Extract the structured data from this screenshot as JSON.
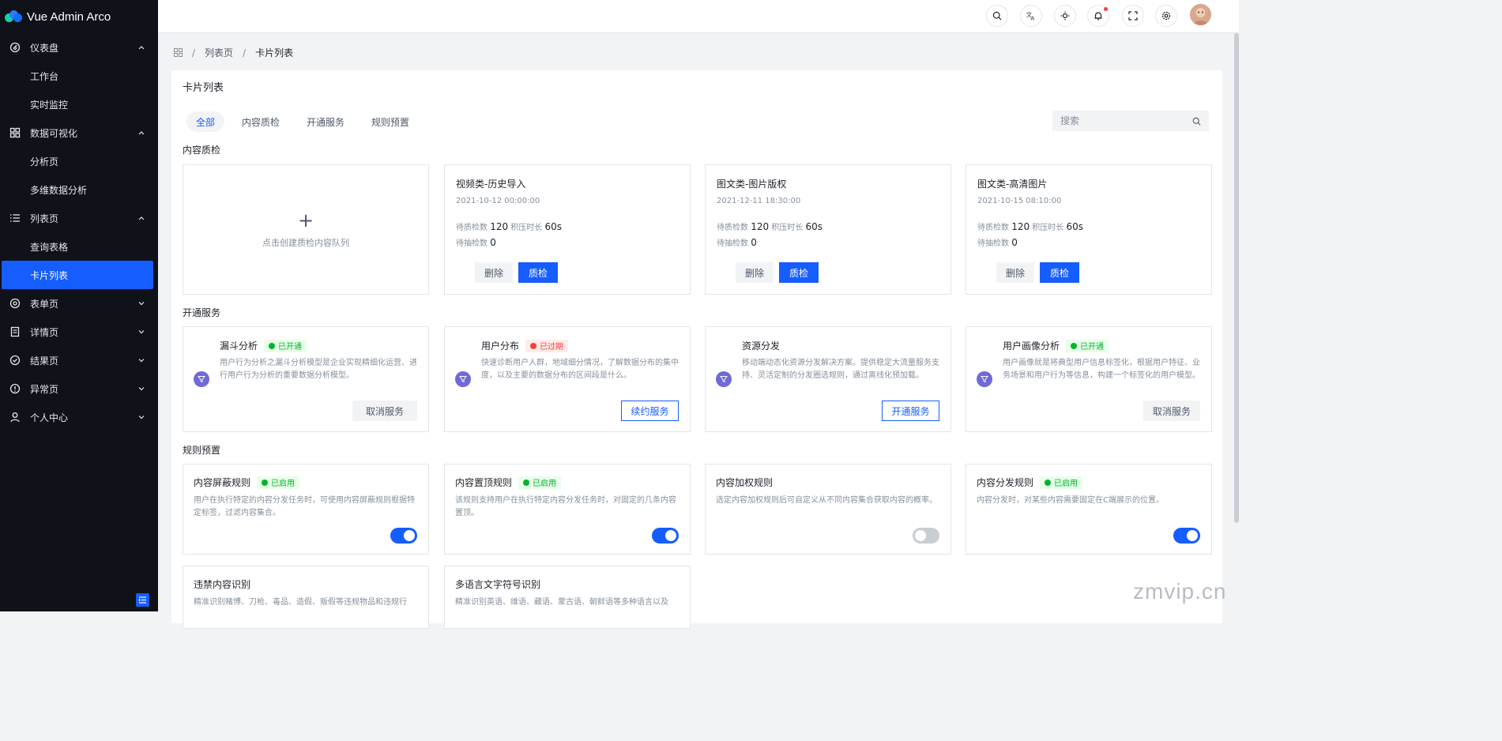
{
  "app": {
    "title": "Vue Admin Arco"
  },
  "sidebar": {
    "groups": [
      {
        "label": "仪表盘",
        "icon": "dashboard-icon",
        "expanded": true,
        "items": [
          "工作台",
          "实时监控"
        ]
      },
      {
        "label": "数据可视化",
        "icon": "grid-icon",
        "expanded": true,
        "items": [
          "分析页",
          "多维数据分析"
        ]
      },
      {
        "label": "列表页",
        "icon": "list-icon",
        "expanded": true,
        "items": [
          "查询表格",
          "卡片列表"
        ]
      },
      {
        "label": "表单页",
        "icon": "settings-icon",
        "expanded": false
      },
      {
        "label": "详情页",
        "icon": "file-icon",
        "expanded": false
      },
      {
        "label": "结果页",
        "icon": "check-circle-icon",
        "expanded": false
      },
      {
        "label": "异常页",
        "icon": "exclamation-circle-icon",
        "expanded": false
      },
      {
        "label": "个人中心",
        "icon": "user-icon",
        "expanded": false
      }
    ],
    "active_item": "卡片列表"
  },
  "header": {
    "icons": [
      "search-icon",
      "translate-icon",
      "theme-icon",
      "notification-icon",
      "fullscreen-icon",
      "settings-icon"
    ],
    "notification_dot": true
  },
  "breadcrumb": {
    "items": [
      "列表页",
      "卡片列表"
    ]
  },
  "page": {
    "title": "卡片列表",
    "tabs": [
      "全部",
      "内容质检",
      "开通服务",
      "规则预置"
    ],
    "active_tab": "全部",
    "search_placeholder": "搜索"
  },
  "quality": {
    "section_title": "内容质检",
    "add_text": "点击创建质检内容队列",
    "add_symbol": "+",
    "pending_label": "待质检数",
    "backlog_label": "积压时长",
    "sampling_label": "待抽检数",
    "delete_label": "删除",
    "inspect_label": "质检",
    "cards": [
      {
        "title": "视频类-历史导入",
        "time": "2021-10-12 00:00:00",
        "pending": "120",
        "backlog": "60s",
        "sampling": "0"
      },
      {
        "title": "图文类-图片版权",
        "time": "2021-12-11 18:30:00",
        "pending": "120",
        "backlog": "60s",
        "sampling": "0"
      },
      {
        "title": "图文类-高清图片",
        "time": "2021-10-15 08:10:00",
        "pending": "120",
        "backlog": "60s",
        "sampling": "0"
      }
    ]
  },
  "services": {
    "section_title": "开通服务",
    "cards": [
      {
        "title": "漏斗分析",
        "tag": "已开通",
        "tag_type": "ok",
        "desc": "用户行为分析之漏斗分析模型是企业实现精细化运营、进行用户行为分析的重要数据分析模型。",
        "action": "取消服务",
        "action_style": "gray"
      },
      {
        "title": "用户分布",
        "tag": "已过期",
        "tag_type": "bad",
        "desc": "快速诊断用户人群，地域细分情况，了解数据分布的集中度，以及主要的数据分布的区间段是什么。",
        "action": "续约服务",
        "action_style": "outline"
      },
      {
        "title": "资源分发",
        "tag": "",
        "tag_type": "",
        "desc": "移动端动态化资源分发解决方案。提供稳定大流量服务支持、灵活定制的分发圈选规则，通过离线化预加载。",
        "action": "开通服务",
        "action_style": "outline"
      },
      {
        "title": "用户画像分析",
        "tag": "已开通",
        "tag_type": "ok",
        "desc": "用户画像就是将典型用户信息标签化，根据用户特征、业务场景和用户行为等信息，构建一个标签化的用户模型。",
        "action": "取消服务",
        "action_style": "gray"
      }
    ]
  },
  "rules": {
    "section_title": "规则预置",
    "cards": [
      {
        "title": "内容屏蔽规则",
        "tag": "已启用",
        "desc": "用户在执行特定的内容分发任务时，可使用内容屏蔽规则根据特定标签，过滤内容集合。",
        "enabled": true
      },
      {
        "title": "内容置顶规则",
        "tag": "已启用",
        "desc": "该规则支持用户在执行特定内容分发任务时，对固定的几条内容置顶。",
        "enabled": true
      },
      {
        "title": "内容加权规则",
        "tag": "",
        "desc": "选定内容加权规则后可自定义从不同内容集合获取内容的概率。",
        "enabled": false
      },
      {
        "title": "内容分发规则",
        "tag": "已启用",
        "desc": "内容分发时，对某些内容需要固定在C端展示的位置。",
        "enabled": true
      },
      {
        "title": "违禁内容识别",
        "tag": "",
        "desc": "精准识别赌博、刀枪、毒品、造假、贩假等违规物品和违规行",
        "enabled": null
      },
      {
        "title": "多语言文字符号识别",
        "tag": "",
        "desc": "精准识别英语、维语、藏语、蒙古语、朝鲜语等多种语言以及",
        "enabled": null
      }
    ]
  },
  "watermark": "zmvip.cn",
  "colors": {
    "primary": "#165dff",
    "sidebar_bg": "#0f1218",
    "success": "#00b42a",
    "danger": "#f53f3f"
  }
}
